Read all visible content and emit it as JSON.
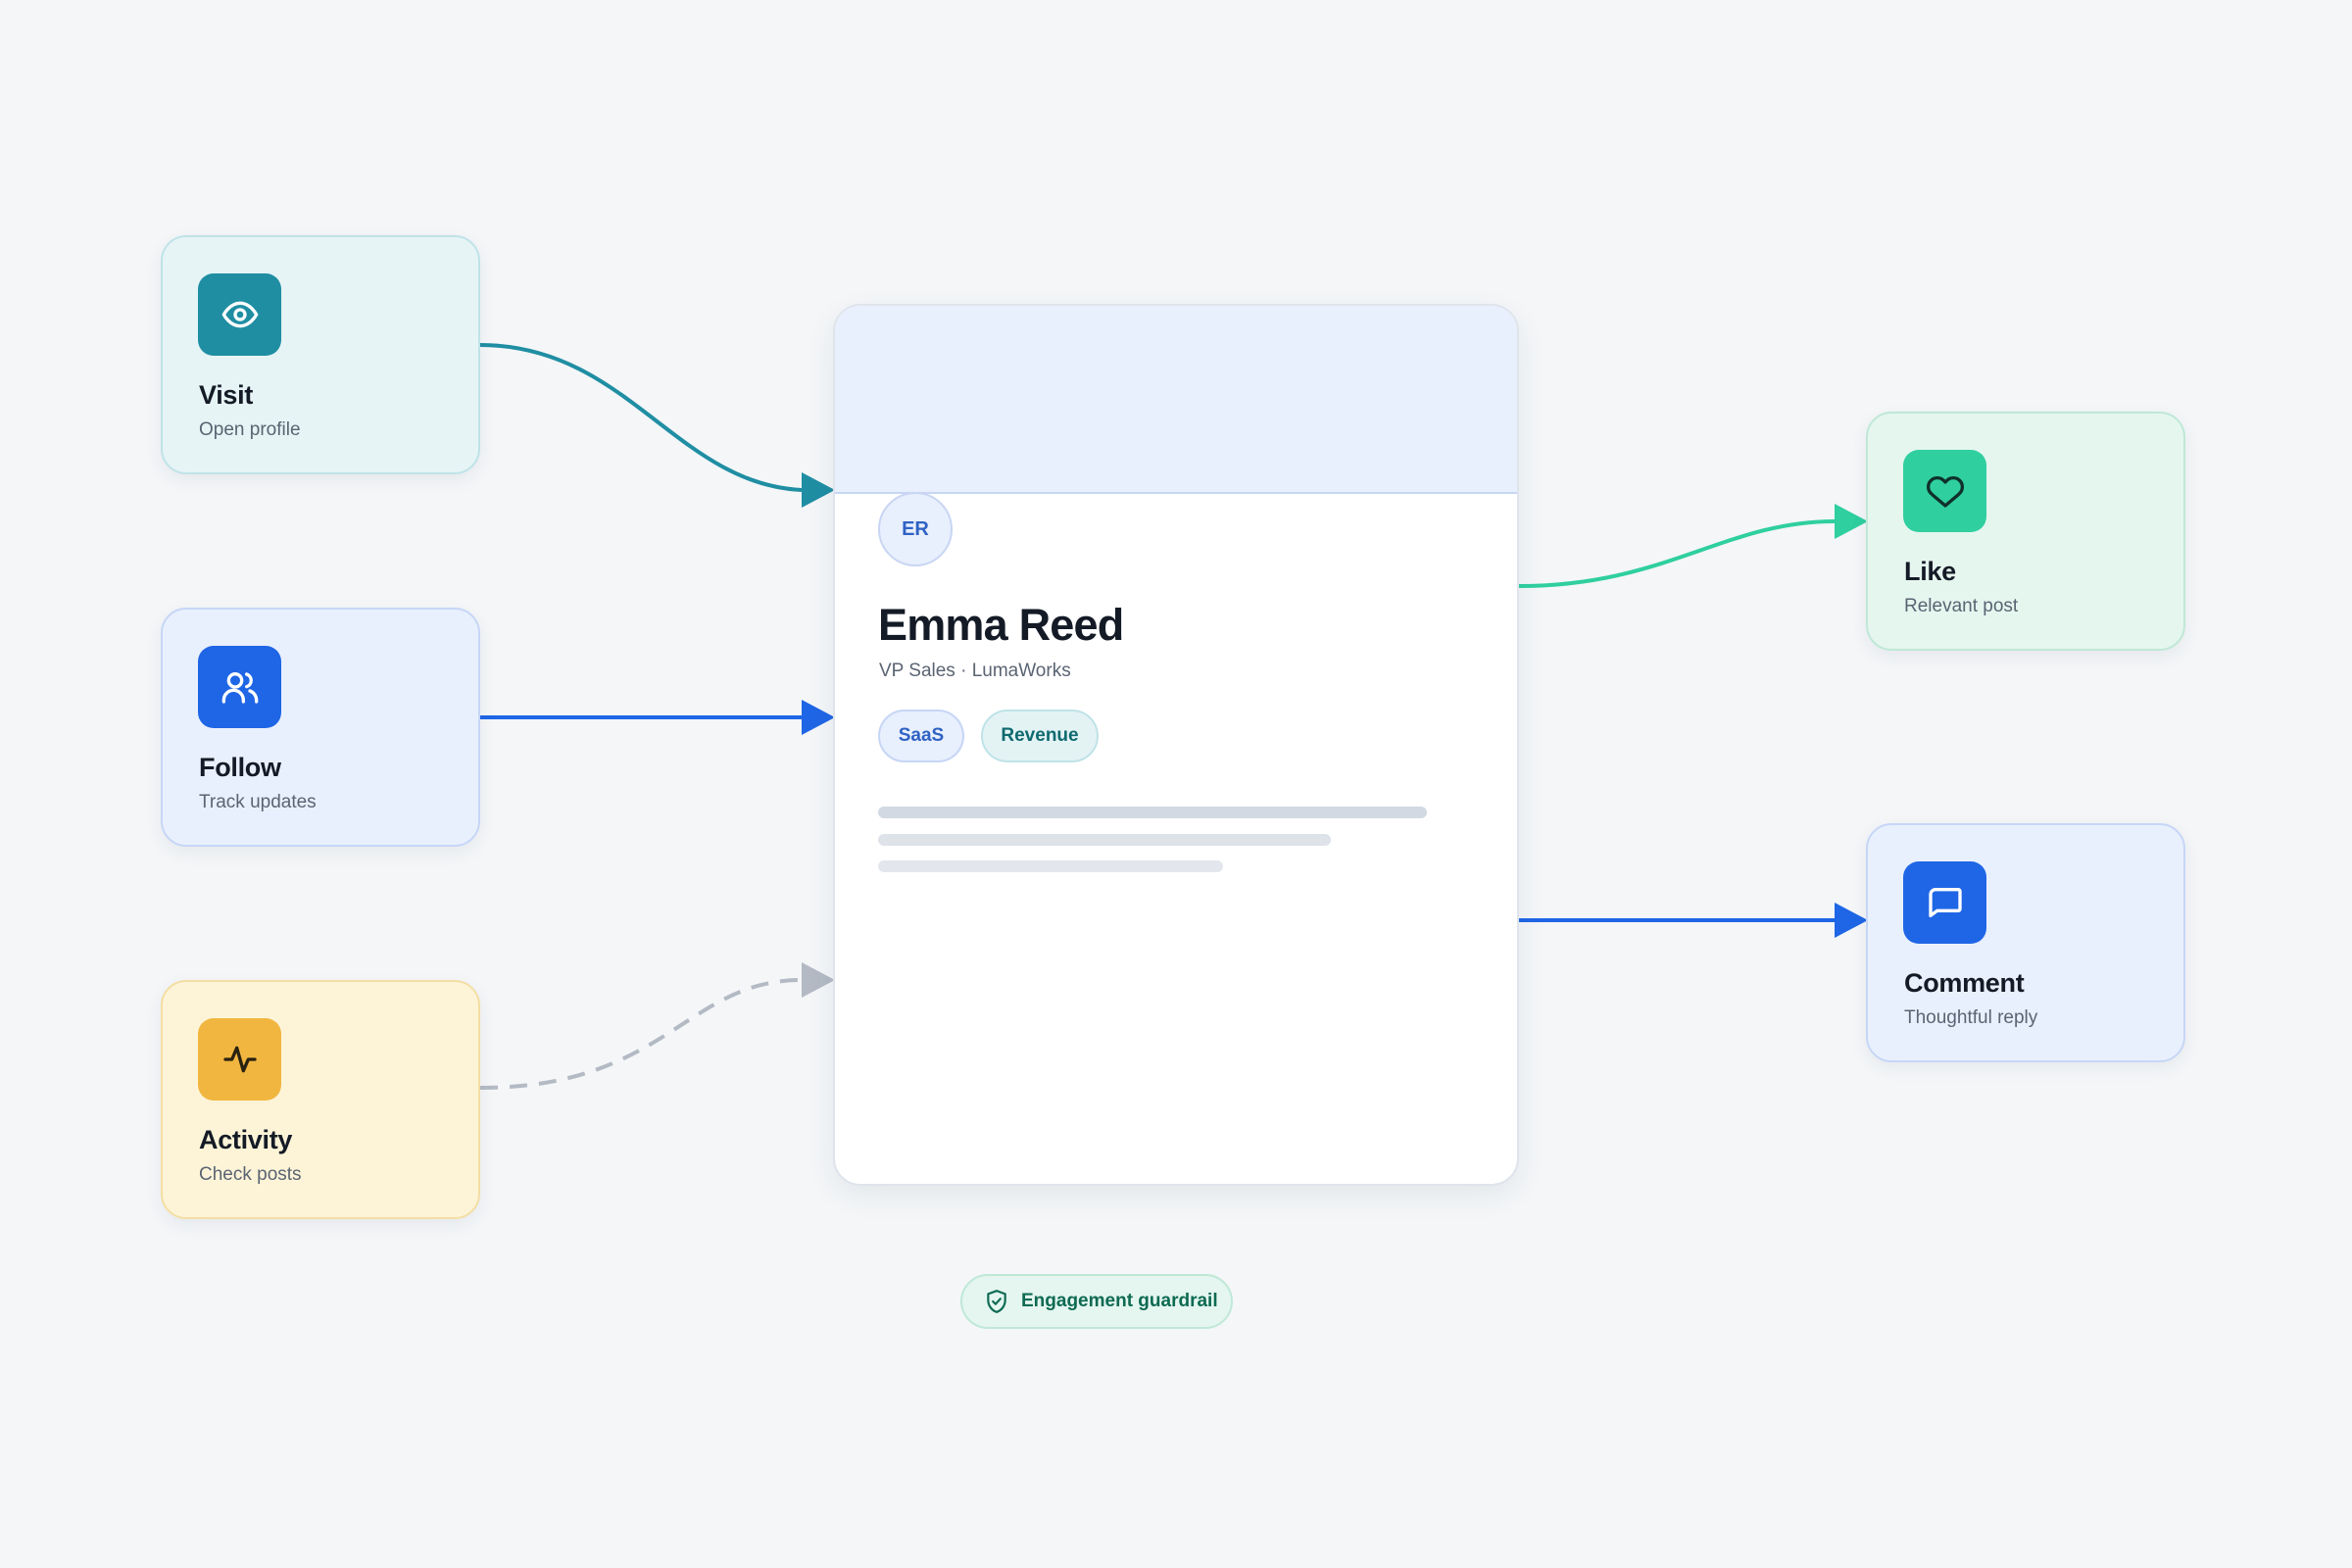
{
  "colors": {
    "visit": "#1f8ea3",
    "follow": "#1f66e6",
    "activity": "#f1b640",
    "like": "#2fcf9f",
    "comment": "#1f66e6",
    "muted_connector": "#b3bac4"
  },
  "inputs": [
    {
      "id": "visit",
      "title": "Visit",
      "subtitle": "Open profile",
      "icon": "eye-icon"
    },
    {
      "id": "follow",
      "title": "Follow",
      "subtitle": "Track updates",
      "icon": "users-icon"
    },
    {
      "id": "activity",
      "title": "Activity",
      "subtitle": "Check posts",
      "icon": "activity-pulse-icon"
    }
  ],
  "outputs": [
    {
      "id": "like",
      "title": "Like",
      "subtitle": "Relevant post",
      "icon": "heart-icon"
    },
    {
      "id": "comment",
      "title": "Comment",
      "subtitle": "Thoughtful reply",
      "icon": "message-square-icon"
    }
  ],
  "profile": {
    "initials": "ER",
    "name": "Emma Reed",
    "role": "VP Sales · LumaWorks",
    "tags": [
      "SaaS",
      "Revenue"
    ]
  },
  "badge": {
    "label": "Engagement guardrail",
    "icon": "shield-check-icon"
  }
}
